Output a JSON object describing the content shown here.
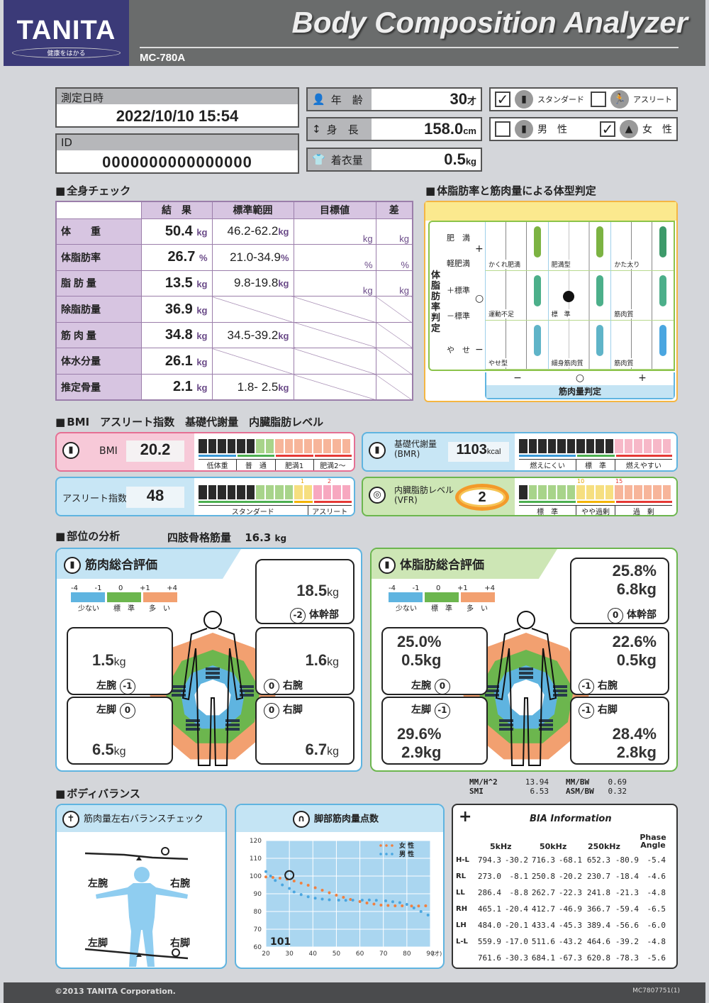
{
  "header": {
    "brand": "TANITA",
    "brand_tagline": "健康をはかる",
    "title": "Body Composition Analyzer",
    "model": "MC-780A"
  },
  "measurement": {
    "datetime_label": "測定日時",
    "datetime": "2022/10/10 15:54",
    "id_label": "ID",
    "id": "0000000000000000"
  },
  "profile": {
    "age": {
      "label": "年　齢",
      "value": "30",
      "unit": "才"
    },
    "height": {
      "label": "身　長",
      "value": "158.0",
      "unit": "cm"
    },
    "clothes": {
      "label": "着衣量",
      "value": "0.5",
      "unit": "kg"
    },
    "body_type": {
      "standard": {
        "label": "スタンダード",
        "checked": true
      },
      "athlete": {
        "label": "アスリート",
        "checked": false
      }
    },
    "sex": {
      "male": {
        "label": "男　性",
        "checked": false
      },
      "female": {
        "label": "女　性",
        "checked": true
      }
    }
  },
  "whole_body": {
    "section_title": "全身チェック",
    "columns": [
      "結　果",
      "標準範囲",
      "目標値",
      "差"
    ],
    "rows": [
      {
        "name": "体　　重",
        "result": "50.4",
        "unit": "kg",
        "range": "46.2-62.2",
        "range_unit": "kg",
        "target_unit": "kg",
        "diff_unit": "kg"
      },
      {
        "name": "体脂肪率",
        "result": "26.7",
        "unit": "%",
        "range": "21.0-34.9",
        "range_unit": "%",
        "target_unit": "%",
        "diff_unit": "%"
      },
      {
        "name": "脂 肪 量",
        "result": "13.5",
        "unit": "kg",
        "range": "9.8-19.8",
        "range_unit": "kg",
        "target_unit": "kg",
        "diff_unit": "kg"
      },
      {
        "name": "除脂肪量",
        "result": "36.9",
        "unit": "kg",
        "range": "",
        "range_unit": "",
        "target_unit": "",
        "diff_unit": ""
      },
      {
        "name": "筋 肉 量",
        "result": "34.8",
        "unit": "kg",
        "range": "34.5-39.2",
        "range_unit": "kg",
        "target_unit": "",
        "diff_unit": ""
      },
      {
        "name": "体水分量",
        "result": "26.1",
        "unit": "kg",
        "range": "",
        "range_unit": "",
        "target_unit": "",
        "diff_unit": ""
      },
      {
        "name": "推定骨量",
        "result": "2.1",
        "unit": "kg",
        "range": "1.8- 2.5",
        "range_unit": "kg",
        "target_unit": "",
        "diff_unit": ""
      }
    ]
  },
  "body_type_judgement": {
    "section_title": "体脂肪率と筋肉量による体型判定",
    "y_axis_title": "体脂肪率判定",
    "x_axis_title": "筋肉量判定",
    "y_labels": [
      "肥　満",
      "軽肥満",
      "＋標準",
      "－標準",
      "や　せ"
    ],
    "y_marks": [
      "+",
      "○",
      "−"
    ],
    "x_marks": [
      "−",
      "○",
      "+"
    ],
    "cells": [
      "かくれ肥満",
      "肥満型",
      "かた太り",
      "運動不足",
      "標　準",
      "筋肉質",
      "やせ型",
      "細身筋肉質",
      "筋肉質"
    ],
    "result_cell": "標　準"
  },
  "indices": {
    "section_title": "BMI　アスリート指数　基礎代謝量　内臓脂肪レベル",
    "bmi": {
      "label": "BMI",
      "value": "20.2",
      "filled": 6,
      "total": 16,
      "segments": [
        "低体重",
        "普　通",
        "肥満1",
        "肥満2〜"
      ]
    },
    "athlete": {
      "label": "アスリート指数",
      "value": "48",
      "filled": 6,
      "total": 16,
      "segments": [
        "スタンダード",
        "アスリート"
      ],
      "marks": [
        "1",
        "2"
      ]
    },
    "bmr": {
      "label": "基礎代謝量",
      "sublabel": "(BMR)",
      "value": "1103",
      "unit": "kcal",
      "filled": 10,
      "total": 16,
      "segments": [
        "燃えにくい",
        "標　準",
        "燃えやすい"
      ]
    },
    "vfr": {
      "label": "内臓脂肪レベル",
      "sublabel": "(VFR)",
      "value": "2",
      "filled": 1,
      "total": 16,
      "segments": [
        "標　準",
        "やや過剰",
        "過　剰"
      ],
      "marks": [
        "10",
        "15"
      ]
    }
  },
  "segmental": {
    "section_title": "部位の分析",
    "limb_smm_label": "四肢骨格筋量",
    "limb_smm_value": "16.3",
    "limb_smm_unit": "kg",
    "legend": {
      "ticks": [
        "-4",
        "-1",
        "0",
        "+1",
        "+4"
      ],
      "labels": [
        "少ない",
        "標　準",
        "多　い"
      ],
      "colors": [
        "#5fb4e0",
        "#6cb64e",
        "#f2a070"
      ]
    },
    "muscle": {
      "title": "筋肉総合評価",
      "trunk": {
        "label": "体幹部",
        "value": "18.5",
        "unit": "kg",
        "score": "-2"
      },
      "left_arm": {
        "label": "左腕",
        "value": "1.5",
        "unit": "kg",
        "score": "-1"
      },
      "right_arm": {
        "label": "右腕",
        "value": "1.6",
        "unit": "kg",
        "score": "0"
      },
      "left_leg": {
        "label": "左脚",
        "value": "6.5",
        "unit": "kg",
        "score": "0"
      },
      "right_leg": {
        "label": "右脚",
        "value": "6.7",
        "unit": "kg",
        "score": "0"
      }
    },
    "fat": {
      "title": "体脂肪総合評価",
      "trunk": {
        "label": "体幹部",
        "percent": "25.8%",
        "value": "6.8kg",
        "score": "0"
      },
      "left_arm": {
        "label": "左腕",
        "percent": "25.0%",
        "value": "0.5kg",
        "score": "0"
      },
      "right_arm": {
        "label": "右腕",
        "percent": "22.6%",
        "value": "0.5kg",
        "score": "-1"
      },
      "left_leg": {
        "label": "左脚",
        "percent": "29.6%",
        "value": "2.9kg",
        "score": "-1"
      },
      "right_leg": {
        "label": "右脚",
        "percent": "28.4%",
        "value": "2.8kg",
        "score": "-1"
      }
    },
    "ratios": [
      {
        "label": "MM/H^2",
        "value": "13.94"
      },
      {
        "label": "MM/BW",
        "value": "0.69"
      },
      {
        "label": "SMI",
        "value": "6.53"
      },
      {
        "label": "ASM/BW",
        "value": "0.32"
      }
    ]
  },
  "body_balance": {
    "section_title": "ボディバランス",
    "title": "筋肉量左右バランスチェック",
    "labels": [
      "左腕",
      "右腕",
      "左脚",
      "右脚"
    ]
  },
  "chart_data": {
    "type": "scatter",
    "title": "脚部筋肉量点数",
    "xlabel": "(才)",
    "ylabel": "",
    "x_ticks": [
      20,
      30,
      40,
      50,
      60,
      70,
      80,
      90
    ],
    "y_ticks": [
      60,
      70,
      80,
      90,
      100,
      110,
      120
    ],
    "xlim": [
      20,
      90
    ],
    "ylim": [
      60,
      120
    ],
    "grid": true,
    "legend": "top-right",
    "series": [
      {
        "name": "女 性",
        "color": "#f08040",
        "x": [
          20,
          23,
          26,
          29,
          32,
          35,
          38,
          41,
          44,
          47,
          50,
          53,
          56,
          60,
          63,
          66,
          69,
          72,
          75,
          78,
          82,
          85,
          88
        ],
        "y": [
          99.5,
          99.2,
          98.8,
          98.2,
          97.2,
          96,
          94.8,
          93.4,
          92,
          90.6,
          89.2,
          88,
          86.8,
          85.6,
          84.8,
          84.2,
          83.6,
          83.4,
          83.2,
          83.2,
          83.1,
          83.1,
          83.2
        ]
      },
      {
        "name": "男 性",
        "color": "#4aa6e0",
        "x": [
          20,
          22,
          24,
          27,
          30,
          32,
          35,
          38,
          41,
          44,
          47,
          51,
          54,
          57,
          61,
          64,
          67,
          71,
          74,
          77,
          80,
          83,
          86,
          89
        ],
        "y": [
          102.5,
          100,
          97.5,
          95,
          93,
          91,
          89.5,
          88.3,
          87.5,
          87,
          86.6,
          86.4,
          86.3,
          86.4,
          86.4,
          86.5,
          86.3,
          86,
          85.5,
          85,
          84,
          82,
          80,
          78
        ]
      }
    ],
    "marker": {
      "x": 30,
      "y": 100.5
    },
    "score_label": "101"
  },
  "bia": {
    "title": "BIA Information",
    "columns": [
      "5kHz",
      "50kHz",
      "250kHz",
      "Phase Angle"
    ],
    "rows": [
      {
        "label": "H-L",
        "values": [
          "794.3",
          "-30.2",
          "716.3",
          "-68.1",
          "652.3",
          "-80.9",
          "-5.4"
        ]
      },
      {
        "label": "RL",
        "values": [
          "273.0",
          "-8.1",
          "250.8",
          "-20.2",
          "230.7",
          "-18.4",
          "-4.6"
        ]
      },
      {
        "label": "LL",
        "values": [
          "286.4",
          "-8.8",
          "262.7",
          "-22.3",
          "241.8",
          "-21.3",
          "-4.8"
        ]
      },
      {
        "label": "RH",
        "values": [
          "465.1",
          "-20.4",
          "412.7",
          "-46.9",
          "366.7",
          "-59.4",
          "-6.5"
        ]
      },
      {
        "label": "LH",
        "values": [
          "484.0",
          "-20.1",
          "433.4",
          "-45.3",
          "389.4",
          "-56.6",
          "-6.0"
        ]
      },
      {
        "label": "L-L",
        "values": [
          "559.9",
          "-17.0",
          "511.6",
          "-43.2",
          "464.6",
          "-39.2",
          "-4.8"
        ]
      },
      {
        "label": "",
        "values": [
          "761.6",
          "-30.3",
          "684.1",
          "-67.3",
          "620.8",
          "-78.3",
          "-5.6"
        ]
      }
    ]
  },
  "footer": {
    "copyright": "©2013 TANITA Corporation.",
    "code": "MC7807751(1)"
  }
}
